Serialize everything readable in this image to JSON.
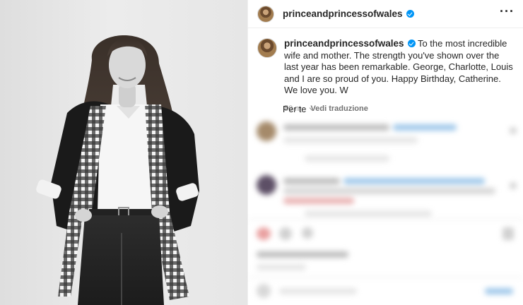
{
  "post": {
    "username": "princeandprincessofwales",
    "caption": "To the most incredible wife and mother. The strength you've shown over the last year has been remarkable. George, Charlotte, Louis and I are so proud of you. Happy Birthday, Catherine. We love you. W",
    "time_ago": "50 m",
    "translate_label": "Vedi traduzione"
  },
  "comments": {
    "sort_label": "Per te"
  },
  "icons": {
    "verified": "verified-badge-icon",
    "more": "more-options-icon",
    "sort": "chevron-down-icon"
  },
  "colors": {
    "verified": "#0095f6",
    "text": "#262626",
    "secondary": "#8e8e8e"
  }
}
